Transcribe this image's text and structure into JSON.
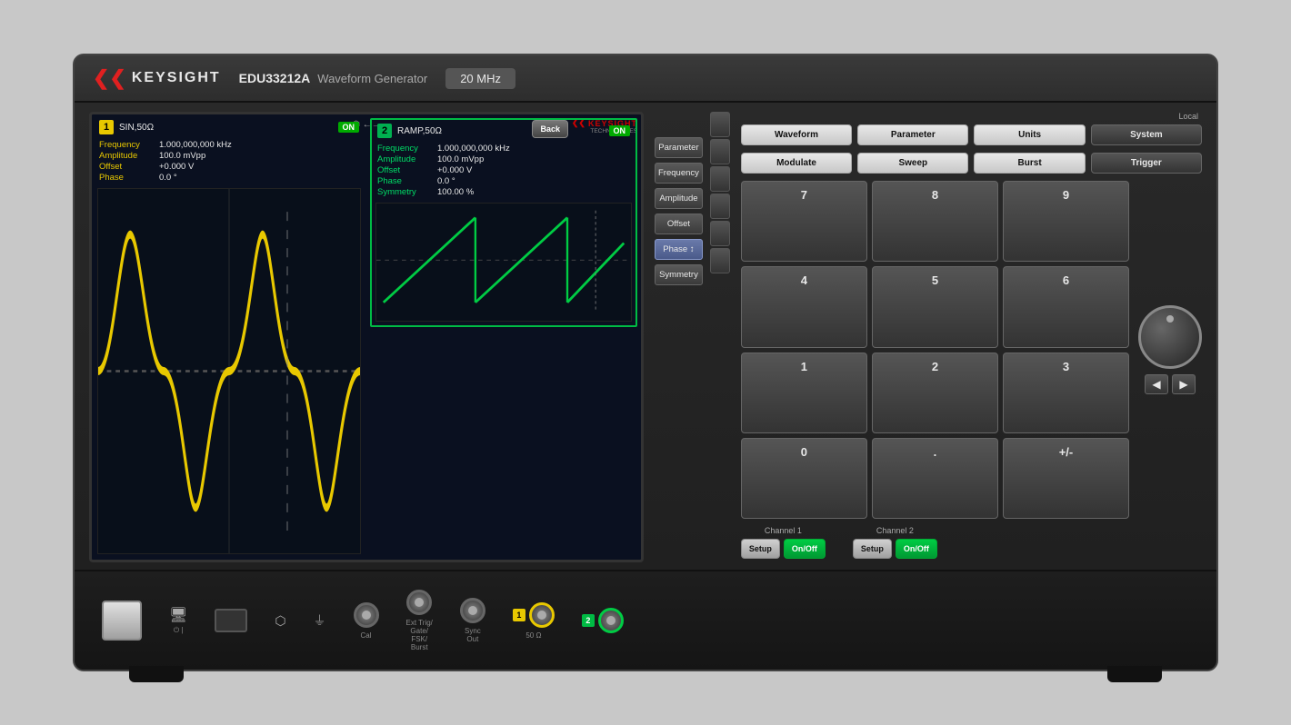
{
  "instrument": {
    "brand": "KEYSIGHT",
    "model": "EDU33212A",
    "type": "Waveform Generator",
    "freq_range": "20 MHz"
  },
  "screen": {
    "usb_symbol": "⬡",
    "channel1": {
      "number": "1",
      "config": "SIN,50Ω",
      "status": "ON",
      "params": {
        "frequency_label": "Frequency",
        "frequency_value": "1.000,000,000 kHz",
        "amplitude_label": "Amplitude",
        "amplitude_value": "100.0 mVpp",
        "offset_label": "Offset",
        "offset_value": "+0.000 V",
        "phase_label": "Phase",
        "phase_value": "0.0 °"
      }
    },
    "channel2": {
      "number": "2",
      "config": "RAMP,50Ω",
      "status": "ON",
      "params": {
        "frequency_label": "Frequency",
        "frequency_value": "1.000,000,000 kHz",
        "amplitude_label": "Amplitude",
        "amplitude_value": "100.0 mVpp",
        "offset_label": "Offset",
        "offset_value": "+0.000 V",
        "phase_label": "Phase",
        "phase_value": "0.0 °",
        "symmetry_label": "Symmetry",
        "symmetry_value": "100.00 %"
      }
    },
    "menu": {
      "header": "Parameter",
      "items": [
        "Frequency",
        "Amplitude",
        "Offset",
        "Phase",
        "Symmetry"
      ]
    }
  },
  "controls": {
    "top_row": [
      "Waveform",
      "Parameter",
      "Units",
      "System"
    ],
    "second_row": [
      "Modulate",
      "Sweep",
      "Burst",
      "Trigger"
    ],
    "local_label": "Local",
    "system_active": true,
    "keypad": [
      "7",
      "8",
      "9",
      "4",
      "5",
      "6",
      "1",
      "2",
      "3",
      "0",
      ".",
      "+/-"
    ],
    "channel1": {
      "label": "Channel 1",
      "setup": "Setup",
      "onoff": "On/Off"
    },
    "channel2": {
      "label": "Channel 2",
      "setup": "Setup",
      "onoff": "On/Off"
    }
  },
  "back_button": "Back",
  "bottom": {
    "cal_label": "Cal",
    "ext_trig_label": "Ext Trig/\nGate/\nFSK/\nBurst",
    "sync_out_label": "Sync\nOut",
    "ch1_label": "1",
    "ch2_label": "2",
    "ohm_label": "50 Ω",
    "usb_symbol": "⬡"
  }
}
